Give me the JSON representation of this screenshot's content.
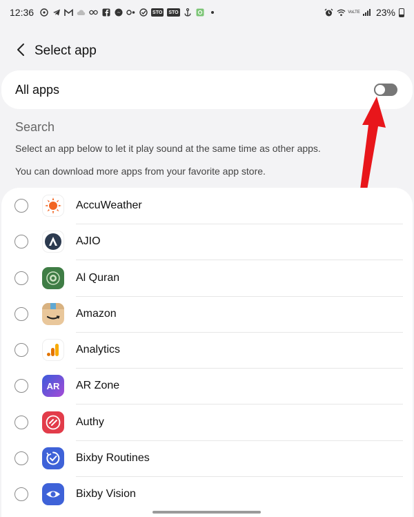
{
  "status_bar": {
    "time": "12:36",
    "badges": [
      "STO",
      "STO"
    ],
    "battery": "23%",
    "network_label": "VoLTE"
  },
  "header": {
    "title": "Select app"
  },
  "all_apps": {
    "label": "All apps",
    "toggle_on": false
  },
  "search_label": "Search",
  "descriptions": [
    "Select an app below to let it play sound at the same time as other apps.",
    "You can download more apps from your favorite app store."
  ],
  "apps": [
    {
      "name": "AccuWeather",
      "icon": "sun-icon",
      "selected": false
    },
    {
      "name": "AJIO",
      "icon": "ajio-icon",
      "selected": false
    },
    {
      "name": "Al Quran",
      "icon": "quran-icon",
      "selected": false
    },
    {
      "name": "Amazon",
      "icon": "amazon-icon",
      "selected": false
    },
    {
      "name": "Analytics",
      "icon": "analytics-icon",
      "selected": false
    },
    {
      "name": "AR Zone",
      "icon": "ar-zone-icon",
      "icon_text": "AR",
      "selected": false
    },
    {
      "name": "Authy",
      "icon": "authy-icon",
      "selected": false
    },
    {
      "name": "Bixby Routines",
      "icon": "bixby-routines-icon",
      "selected": false
    },
    {
      "name": "Bixby Vision",
      "icon": "bixby-vision-icon",
      "selected": false
    }
  ],
  "colors": {
    "background": "#f3f3f5",
    "card": "#ffffff",
    "toggle_off": "#777777",
    "annotation_arrow": "#e8161b"
  }
}
